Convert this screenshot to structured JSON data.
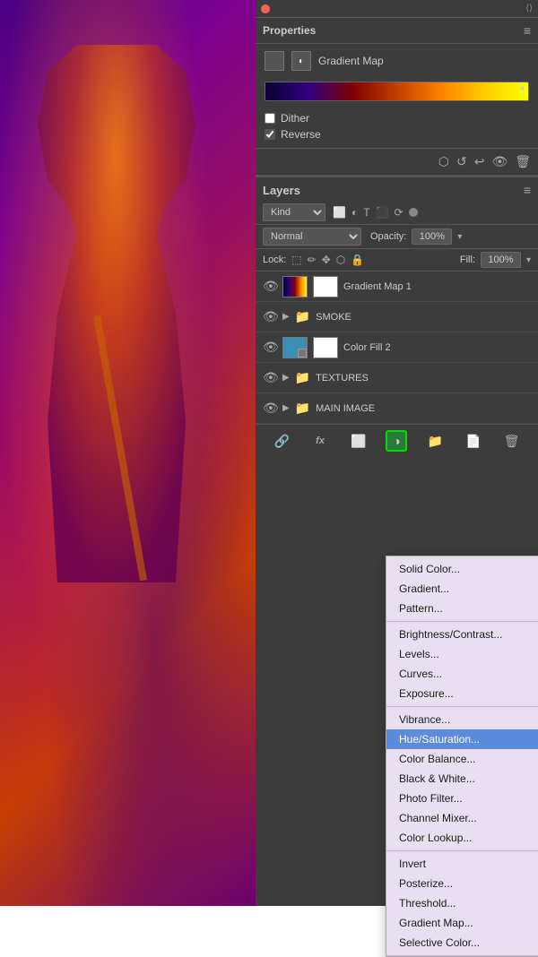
{
  "background": {
    "description": "Purple/orange toned photo of person with microphone"
  },
  "properties_panel": {
    "title": "Properties",
    "gradient_map_label": "Gradient Map",
    "dither_label": "Dither",
    "reverse_label": "Reverse",
    "dither_checked": false,
    "reverse_checked": true
  },
  "layers_panel": {
    "title": "Layers",
    "kind_label": "Kind",
    "blend_mode": "Normal",
    "opacity_label": "Opacity:",
    "opacity_value": "100%",
    "lock_label": "Lock:",
    "fill_label": "Fill:",
    "fill_value": "100%",
    "layers": [
      {
        "name": "Gradient Map 1",
        "type": "adjustment",
        "visible": true,
        "active": false
      },
      {
        "name": "SMOKE",
        "type": "group",
        "visible": true,
        "active": false
      },
      {
        "name": "Color Fill 2",
        "type": "fill",
        "visible": true,
        "active": false
      },
      {
        "name": "TEXTURES",
        "type": "group",
        "visible": true,
        "active": false
      },
      {
        "name": "MAIN IMAGE",
        "type": "group",
        "visible": true,
        "active": false
      }
    ],
    "toolbar_icons": [
      "link",
      "fx",
      "mask",
      "adjustment",
      "folder",
      "duplicate",
      "delete"
    ]
  },
  "dropdown_menu": {
    "sections": [
      {
        "items": [
          "Solid Color...",
          "Gradient...",
          "Pattern..."
        ]
      },
      {
        "items": [
          "Brightness/Contrast...",
          "Levels...",
          "Curves...",
          "Exposure..."
        ]
      },
      {
        "items": [
          "Vibrance...",
          "Hue/Saturation...",
          "Color Balance...",
          "Black & White...",
          "Photo Filter...",
          "Channel Mixer...",
          "Color Lookup..."
        ]
      },
      {
        "items": [
          "Invert",
          "Posterize...",
          "Threshold...",
          "Gradient Map...",
          "Selective Color..."
        ]
      }
    ],
    "highlighted_item": "Hue/Saturation..."
  }
}
